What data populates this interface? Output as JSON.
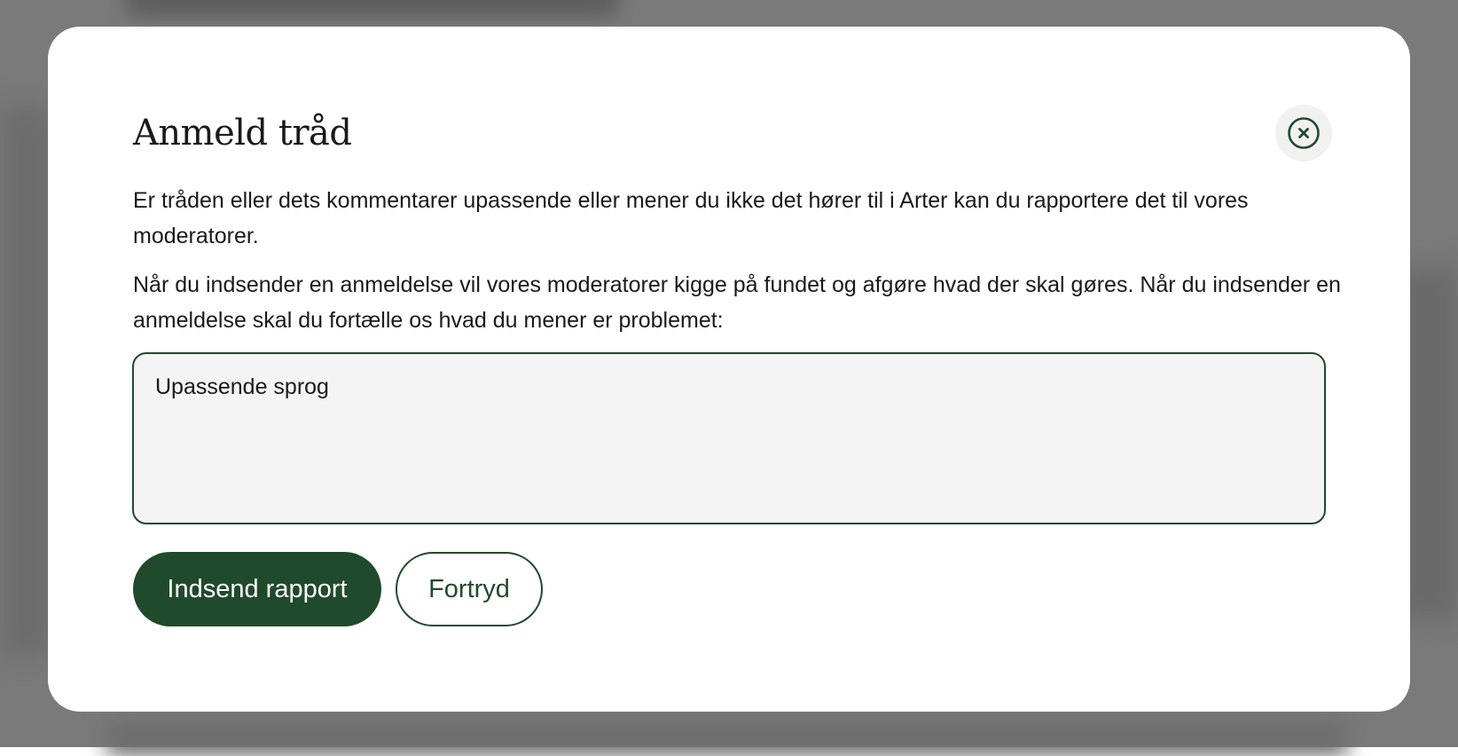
{
  "dialog": {
    "title": "Anmeld tråd",
    "close_icon": "close-circle-icon",
    "paragraph_1": "Er tråden eller dets kommentarer upassende eller mener du ikke det hører til i Arter kan du rapportere det til vores moderatorer.",
    "paragraph_2": "Når du indsender en anmeldelse vil vores moderatorer kigge på fundet og afgøre hvad der skal gøres. Når du indsender en anmeldelse skal du fortælle os hvad du mener er problemet:",
    "reason_value": "Upassende sprog",
    "submit_label": "Indsend rapport",
    "cancel_label": "Fortryd"
  },
  "colors": {
    "accent": "#204a2c",
    "field_background": "#f4f4f4",
    "overlay": "#7a7a7a"
  }
}
